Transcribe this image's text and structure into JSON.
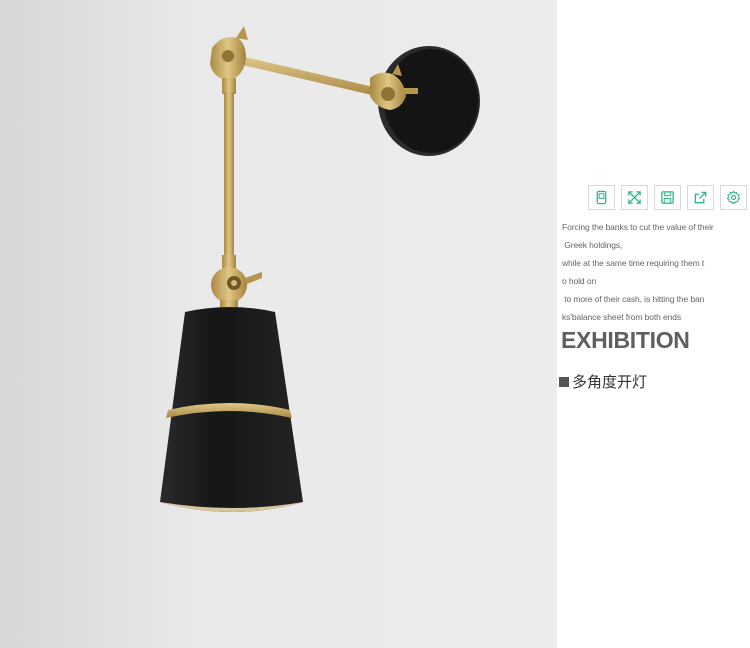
{
  "photo": {
    "subject": "wall-lamp-photo",
    "colors": {
      "wall": "#e6e6e6",
      "shade": "#1a1a1a",
      "brass": "#c2a25a"
    }
  },
  "toolbar": {
    "accent_color": "#2fb885",
    "icons": [
      "tablet-icon",
      "fullscreen-icon",
      "save-icon",
      "share-icon",
      "settings-icon"
    ]
  },
  "description": {
    "lines": [
      "Forcing the banks to cut the value of their",
      " Greek holdings,",
      "while at the same time requiring them t",
      "o hold on",
      " to more of their cash, is hitting the ban",
      "ks'balance sheet from both ends"
    ]
  },
  "heading": "EXHIBITION",
  "feature": {
    "label": "多角度开灯"
  }
}
